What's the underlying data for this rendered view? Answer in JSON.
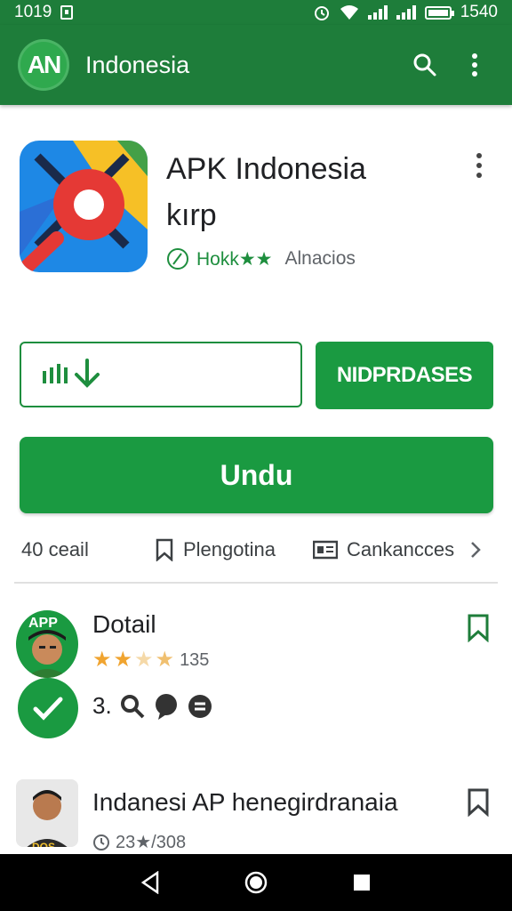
{
  "status_bar": {
    "time": "1019",
    "right_text": "1540"
  },
  "app_bar": {
    "logo_text": "AN",
    "title": "Indonesia",
    "icons": [
      "search-icon",
      "more-vert-icon"
    ]
  },
  "app": {
    "name_line1": "APK Indonesia",
    "name_line2": "kırp",
    "rating_text": "Hokk★★",
    "developer": "Alnacios"
  },
  "buttons": {
    "secondary": "NIDPRDASES",
    "primary": "Undu"
  },
  "info_row": {
    "downloads": "40 ceail",
    "item2": "Plengotina",
    "item3": "Cankancces"
  },
  "list": [
    {
      "title": "Dotail",
      "rating_count": "135",
      "stats": "3.",
      "badge_text": "APP"
    },
    {
      "title": "Indanesi AP henegirdranaia",
      "rating_text": "23★/308"
    }
  ],
  "colors": {
    "primary_green": "#1a9a41",
    "bar_green": "#1e7d3a"
  }
}
